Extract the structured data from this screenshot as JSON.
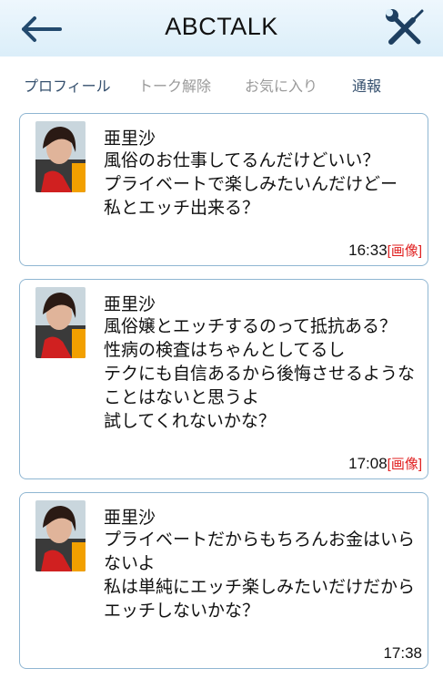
{
  "header": {
    "title": "ABCTALK"
  },
  "menu": {
    "profile": "プロフィール",
    "unlock_talk": "トーク解除",
    "favorite": "お気に入り",
    "report": "通報"
  },
  "messages": [
    {
      "sender": "亜里沙",
      "text": "風俗のお仕事してるんだけどいい？\nプライベートで楽しみたいんだけどー\n私とエッチ出来る？",
      "time": "16:33",
      "image_tag": "[画像]"
    },
    {
      "sender": "亜里沙",
      "text": "風俗嬢とエッチするのって抵抗ある？\n性病の検査はちゃんとしてるし\nテクにも自信あるから後悔させるようなことはないと思うよ\n試してくれないかな？",
      "time": "17:08",
      "image_tag": "[画像]"
    },
    {
      "sender": "亜里沙",
      "text": "プライベートだからもちろんお金はいらないよ\n私は単純にエッチ楽しみたいだけだから\nエッチしないかな？",
      "time": "17:38",
      "image_tag": ""
    }
  ],
  "colors": {
    "header_bg": "#dbeef9",
    "card_border": "#8fb6d2",
    "image_tag": "#e02020",
    "menu_active": "#35506e",
    "menu_dim": "#9a9a9a"
  },
  "icons": {
    "back": "back-arrow-icon",
    "tools": "tools-icon",
    "avatar": "avatar"
  }
}
